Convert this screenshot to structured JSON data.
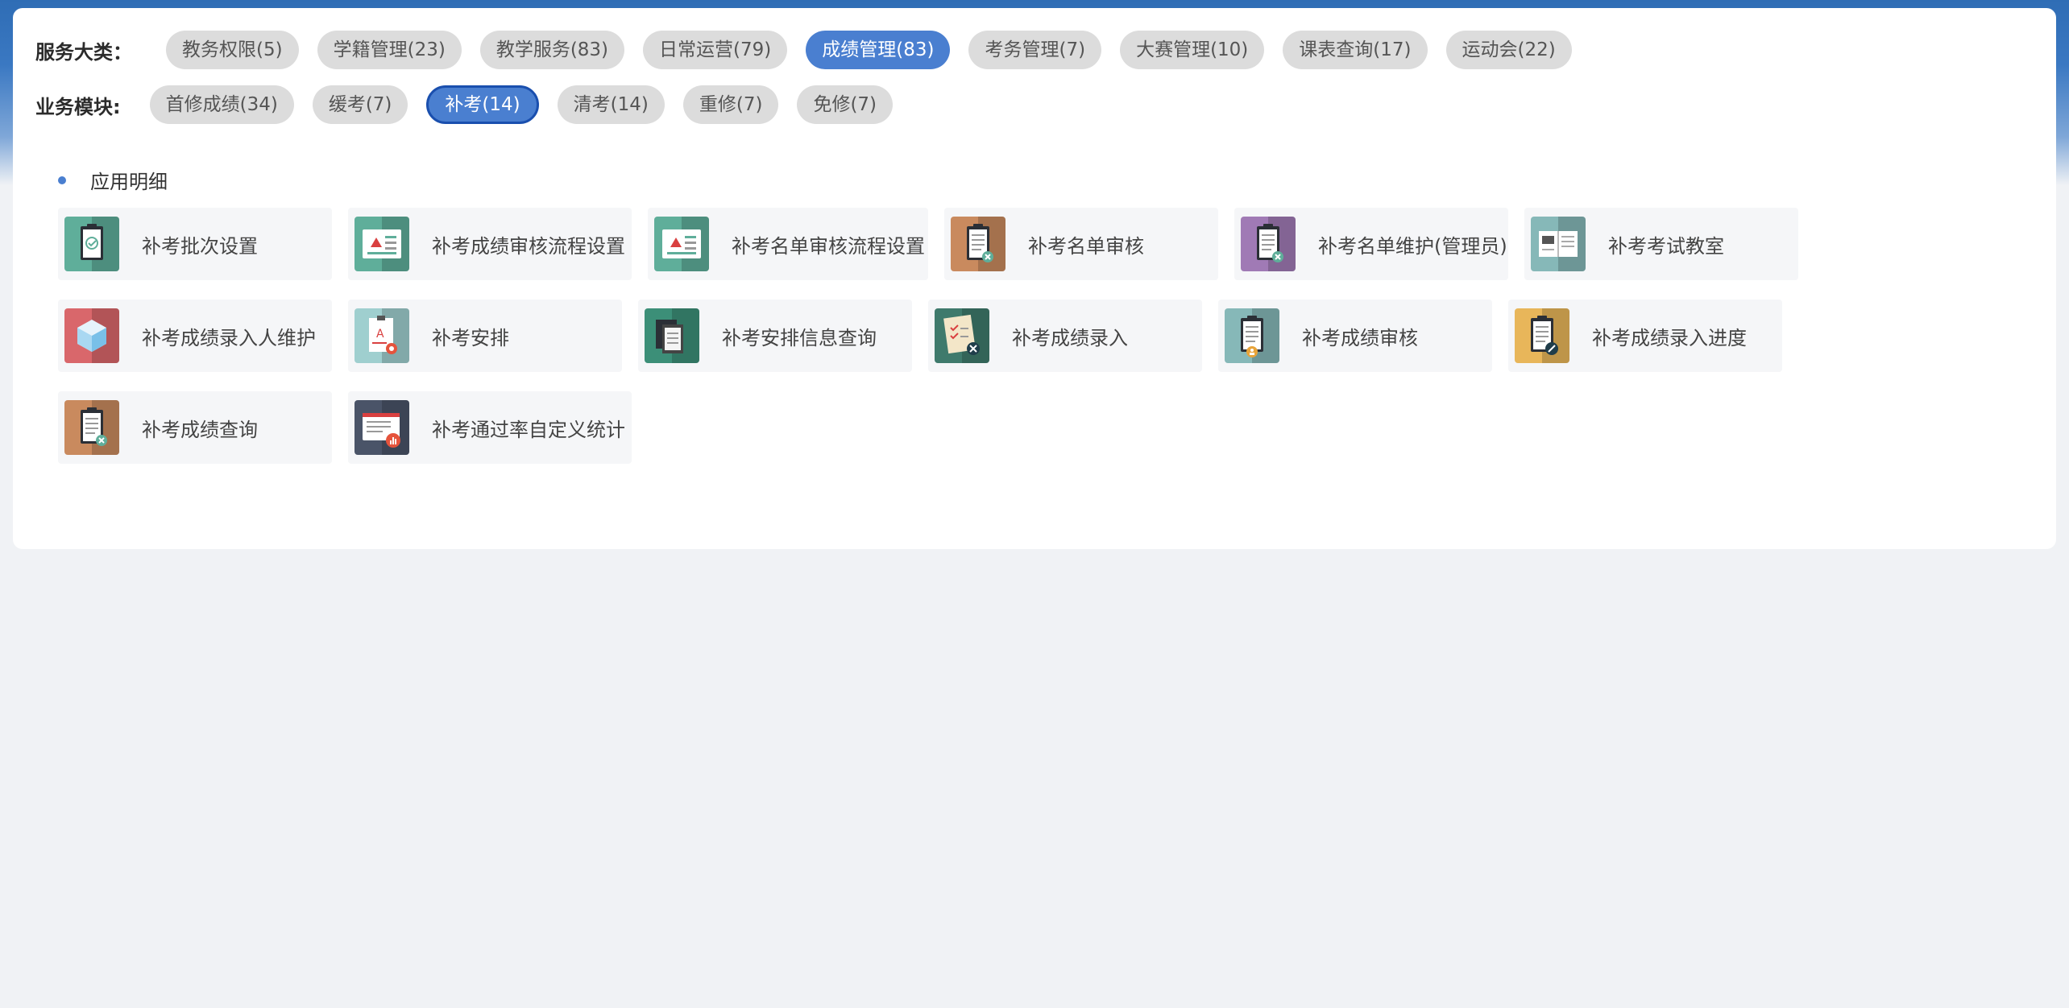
{
  "filters": {
    "category_label": "服务大类：",
    "categories": [
      "教务权限(5)",
      "学籍管理(23)",
      "教学服务(83)",
      "日常运营(79)",
      "成绩管理(83)",
      "考务管理(7)",
      "大赛管理(10)",
      "课表查询(17)",
      "运动会(22)"
    ],
    "active_category": "成绩管理(83)",
    "module_label": "业务模块:",
    "modules": [
      "首修成绩(34)",
      "缓考(7)",
      "补考(14)",
      "清考(14)",
      "重修(7)",
      "免修(7)"
    ],
    "active_module": "补考(14)"
  },
  "section": {
    "title": "应用明细"
  },
  "apps": [
    {
      "name": "补考批次设置",
      "icon": "clipboard-check-icon",
      "color": "#5fae9a"
    },
    {
      "name": "补考成绩审核流程设置",
      "icon": "warning-list-icon",
      "color": "#5fae9a"
    },
    {
      "name": "补考名单审核流程设置",
      "icon": "warning-list-icon",
      "color": "#5fae9a"
    },
    {
      "name": "补考名单审核",
      "icon": "clipboard-tools-icon",
      "color": "#c98a5e"
    },
    {
      "name": "补考名单维护(管理员)",
      "icon": "clipboard-tools-icon",
      "color": "#a07ab5"
    },
    {
      "name": "补考考试教室",
      "icon": "open-book-icon",
      "color": "#86b8b8"
    },
    {
      "name": "补考成绩录入人维护",
      "icon": "cube-icon",
      "color": "#d9676b"
    },
    {
      "name": "补考安排",
      "icon": "exam-paper-gear-icon",
      "color": "#9fcfcf"
    },
    {
      "name": "补考安排信息查询",
      "icon": "documents-icon",
      "color": "#3c8f78"
    },
    {
      "name": "补考成绩录入",
      "icon": "checklist-tools-icon",
      "color": "#3f7a6c"
    },
    {
      "name": "补考成绩审核",
      "icon": "clipboard-user-icon",
      "color": "#86b8b8"
    },
    {
      "name": "补考成绩录入进度",
      "icon": "clipboard-pencil-icon",
      "color": "#e8b65a"
    },
    {
      "name": "补考成绩查询",
      "icon": "clipboard-tools-icon",
      "color": "#c98a5e"
    },
    {
      "name": "补考通过率自定义统计",
      "icon": "report-chart-icon",
      "color": "#4a5468"
    }
  ]
}
